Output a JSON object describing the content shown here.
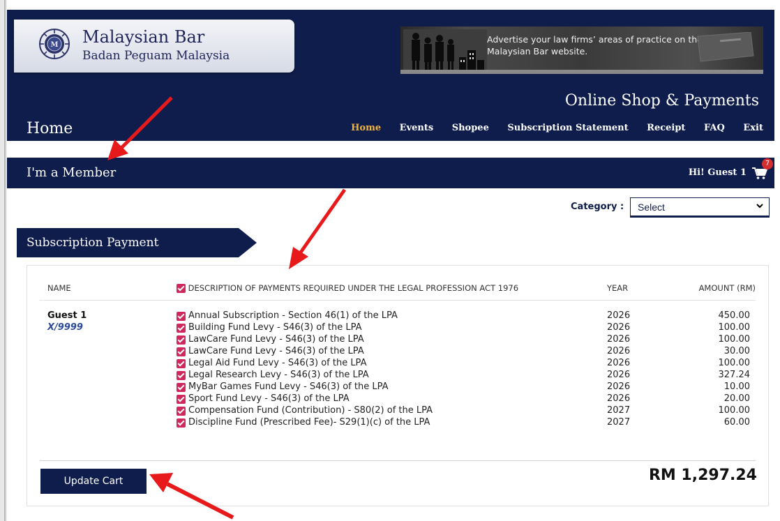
{
  "branding": {
    "name": "Malaysian Bar",
    "subname": "Badan Peguam Malaysia",
    "logo": "malaysian-bar-crest"
  },
  "ad": {
    "text": "Advertise your law firms’ areas of practice on the Malaysian Bar website."
  },
  "header": {
    "shop_title": "Online Shop & Payments",
    "page_title": "Home"
  },
  "nav": {
    "items": [
      "Home",
      "Events",
      "Shopee",
      "Subscription Statement",
      "Receipt",
      "FAQ",
      "Exit"
    ],
    "active": "Home"
  },
  "member_bar": {
    "title": "I'm a Member",
    "greeting": "Hi! Guest 1",
    "cart_icon": "shopping-cart-icon",
    "cart_count": "7"
  },
  "category": {
    "label": "Category :",
    "selected": "Select"
  },
  "section_tab": {
    "label": "Subscription Payment"
  },
  "table": {
    "headers": {
      "name": "NAME",
      "description": "DESCRIPTION OF PAYMENTS REQUIRED UNDER THE LEGAL PROFESSION ACT 1976",
      "year": "YEAR",
      "amount": "AMOUNT (RM)"
    },
    "member_name": "Guest 1",
    "member_no": "X/9999",
    "rows": [
      {
        "description": "Annual Subscription - Section 46(1) of the LPA",
        "year": "2026",
        "amount": "450.00",
        "checked": true
      },
      {
        "description": "Building Fund Levy - S46(3) of the LPA",
        "year": "2026",
        "amount": "100.00",
        "checked": true
      },
      {
        "description": "LawCare Fund Levy - S46(3) of the LPA",
        "year": "2026",
        "amount": "100.00",
        "checked": true
      },
      {
        "description": "LawCare Fund Levy - S46(3) of the LPA",
        "year": "2026",
        "amount": "30.00",
        "checked": true
      },
      {
        "description": "Legal Aid Fund Levy - S46(3) of the LPA",
        "year": "2026",
        "amount": "100.00",
        "checked": true
      },
      {
        "description": "Legal Research Levy - S46(3) of the LPA",
        "year": "2026",
        "amount": "327.24",
        "checked": true
      },
      {
        "description": "MyBar Games Fund Levy - S46(3) of the LPA",
        "year": "2026",
        "amount": "10.00",
        "checked": true
      },
      {
        "description": "Sport Fund Levy - S46(3) of the LPA",
        "year": "2026",
        "amount": "20.00",
        "checked": true
      },
      {
        "description": "Compensation Fund (Contribution) - S80(2) of the LPA",
        "year": "2027",
        "amount": "100.00",
        "checked": true
      },
      {
        "description": "Discipline Fund (Prescribed Fee)- S29(1)(c) of the LPA",
        "year": "2027",
        "amount": "60.00",
        "checked": true
      }
    ]
  },
  "update_button": "Update Cart",
  "total": "RM 1,297.24",
  "colors": {
    "brand_navy": "#0f1d4c",
    "nav_active": "#f0b33c",
    "checkbox": "#d0285d",
    "annotation_arrow": "#e8191a"
  }
}
